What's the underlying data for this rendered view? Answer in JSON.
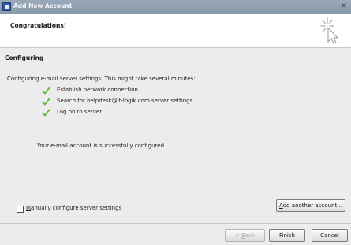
{
  "window": {
    "title": "Add New Account",
    "close_glyph": "×"
  },
  "banner": {
    "title": "Congratulations!",
    "icon": "sparkle-cursor-icon"
  },
  "section": {
    "title": "Configuring",
    "lead": "Configuring e-mail server settings. This might take several minutes:",
    "steps": [
      {
        "label": "Establish network connection",
        "status_icon": "check-icon"
      },
      {
        "label": "Search for helpdesk@it-logik.com server settings",
        "status_icon": "check-icon"
      },
      {
        "label": "Log on to server",
        "status_icon": "check-icon"
      }
    ],
    "success_message": "Your e-mail account is successfully configured."
  },
  "options": {
    "manual_config": {
      "label_rest": "anually configure server settings",
      "label_mnemonic": "M",
      "checked": false
    }
  },
  "buttons": {
    "add_another": {
      "label_mnemonic": "A",
      "label_rest": "dd another account..."
    },
    "back": {
      "label_prefix": "< ",
      "label_mnemonic": "B",
      "label_rest": "ack",
      "enabled": false
    },
    "finish": {
      "label": "Finish"
    },
    "cancel": {
      "label": "Cancel"
    }
  },
  "colors": {
    "check": "#5fb53a",
    "titlebar": "#8a98ab",
    "dialog_bg": "#ececec"
  }
}
